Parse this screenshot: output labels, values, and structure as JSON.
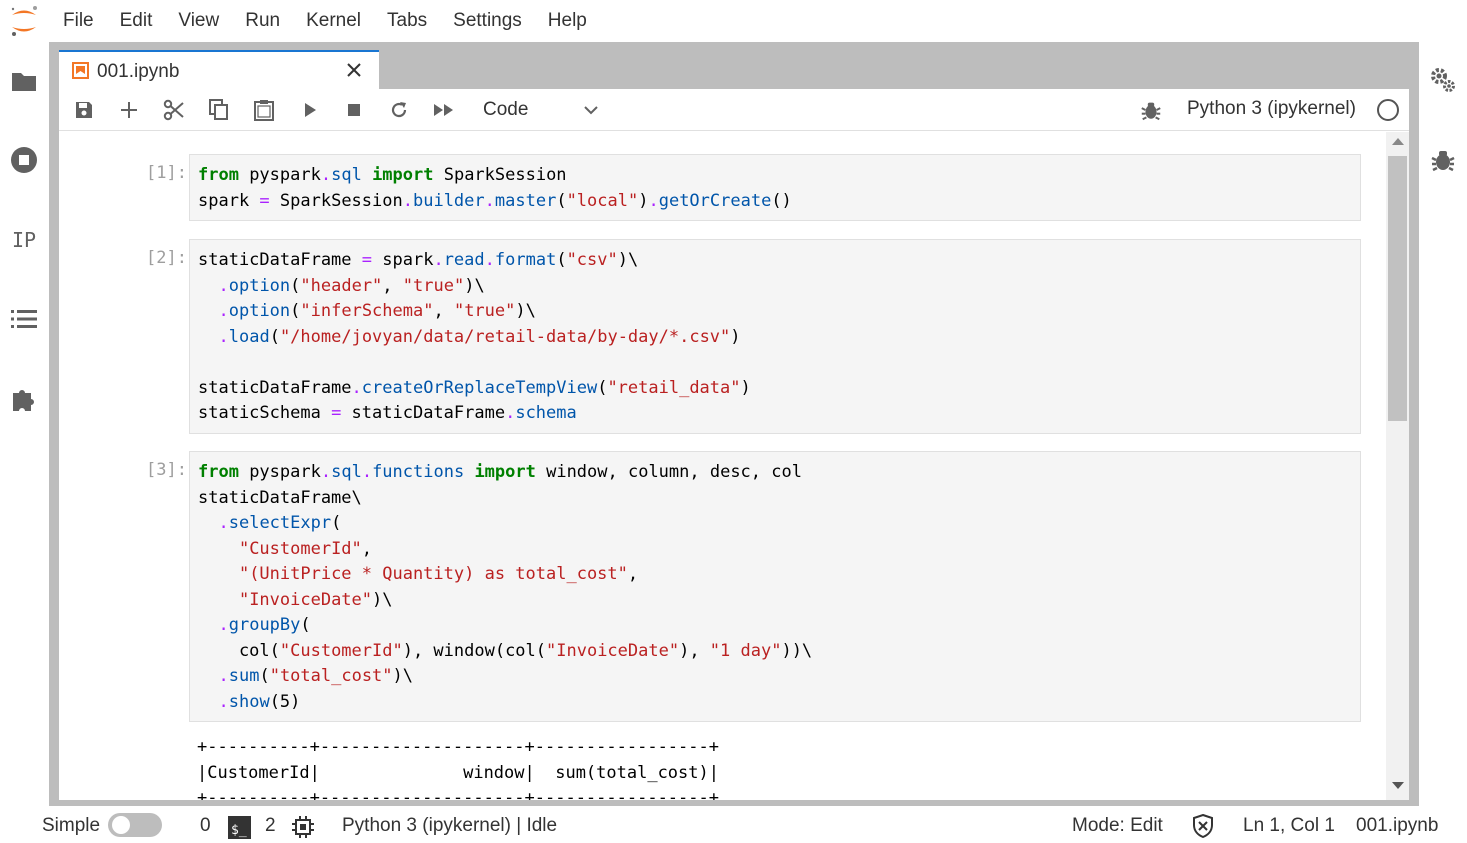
{
  "menubar": {
    "items": [
      "File",
      "Edit",
      "View",
      "Run",
      "Kernel",
      "Tabs",
      "Settings",
      "Help"
    ]
  },
  "left_sidebar": {
    "icons": [
      "folder-icon",
      "running-icon",
      "property-inspector-icon",
      "toc-icon",
      "extension-icon"
    ],
    "ip_label": "IP"
  },
  "right_sidebar": {
    "icons": [
      "property-settings-icon",
      "debugger-icon"
    ]
  },
  "tab": {
    "title": "001.ipynb"
  },
  "toolbar": {
    "buttons": [
      "save-icon",
      "add-icon",
      "cut-icon",
      "copy-icon",
      "paste-icon",
      "run-icon",
      "stop-icon",
      "restart-icon",
      "run-all-icon"
    ],
    "cell_type": "Code",
    "kernel_name": "Python 3 (ipykernel)"
  },
  "cells": [
    {
      "prompt": "[1]:",
      "lines": [
        [
          [
            "kw",
            "from"
          ],
          [
            "t",
            " pyspark"
          ],
          [
            "op",
            "."
          ],
          [
            "attr",
            "sql"
          ],
          [
            "t",
            " "
          ],
          [
            "kw",
            "import"
          ],
          [
            "t",
            " SparkSession"
          ]
        ],
        [
          [
            "t",
            "spark "
          ],
          [
            "op",
            "="
          ],
          [
            "t",
            " SparkSession"
          ],
          [
            "op",
            "."
          ],
          [
            "attr",
            "builder"
          ],
          [
            "op",
            "."
          ],
          [
            "attr",
            "master"
          ],
          [
            "t",
            "("
          ],
          [
            "str",
            "\"local\""
          ],
          [
            "t",
            ")"
          ],
          [
            "op",
            "."
          ],
          [
            "attr",
            "getOrCreate"
          ],
          [
            "t",
            "()"
          ]
        ]
      ]
    },
    {
      "prompt": "[2]:",
      "lines": [
        [
          [
            "t",
            "staticDataFrame "
          ],
          [
            "op",
            "="
          ],
          [
            "t",
            " spark"
          ],
          [
            "op",
            "."
          ],
          [
            "attr",
            "read"
          ],
          [
            "op",
            "."
          ],
          [
            "attr",
            "format"
          ],
          [
            "t",
            "("
          ],
          [
            "str",
            "\"csv\""
          ],
          [
            "t",
            ")\\"
          ]
        ],
        [
          [
            "t",
            "  "
          ],
          [
            "op",
            "."
          ],
          [
            "attr",
            "option"
          ],
          [
            "t",
            "("
          ],
          [
            "str",
            "\"header\""
          ],
          [
            "t",
            ", "
          ],
          [
            "str",
            "\"true\""
          ],
          [
            "t",
            ")\\"
          ]
        ],
        [
          [
            "t",
            "  "
          ],
          [
            "op",
            "."
          ],
          [
            "attr",
            "option"
          ],
          [
            "t",
            "("
          ],
          [
            "str",
            "\"inferSchema\""
          ],
          [
            "t",
            ", "
          ],
          [
            "str",
            "\"true\""
          ],
          [
            "t",
            ")\\"
          ]
        ],
        [
          [
            "t",
            "  "
          ],
          [
            "op",
            "."
          ],
          [
            "attr",
            "load"
          ],
          [
            "t",
            "("
          ],
          [
            "str",
            "\"/home/jovyan/data/retail-data/by-day/*.csv\""
          ],
          [
            "t",
            ")"
          ]
        ],
        [],
        [
          [
            "t",
            "staticDataFrame"
          ],
          [
            "op",
            "."
          ],
          [
            "attr",
            "createOrReplaceTempView"
          ],
          [
            "t",
            "("
          ],
          [
            "str",
            "\"retail_data\""
          ],
          [
            "t",
            ")"
          ]
        ],
        [
          [
            "t",
            "staticSchema "
          ],
          [
            "op",
            "="
          ],
          [
            "t",
            " staticDataFrame"
          ],
          [
            "op",
            "."
          ],
          [
            "attr",
            "schema"
          ]
        ]
      ]
    },
    {
      "prompt": "[3]:",
      "lines": [
        [
          [
            "kw",
            "from"
          ],
          [
            "t",
            " pyspark"
          ],
          [
            "op",
            "."
          ],
          [
            "attr",
            "sql"
          ],
          [
            "op",
            "."
          ],
          [
            "attr",
            "functions"
          ],
          [
            "t",
            " "
          ],
          [
            "kw",
            "import"
          ],
          [
            "t",
            " window, column, desc, col"
          ]
        ],
        [
          [
            "t",
            "staticDataFrame\\"
          ]
        ],
        [
          [
            "t",
            "  "
          ],
          [
            "op",
            "."
          ],
          [
            "attr",
            "selectExpr"
          ],
          [
            "t",
            "("
          ]
        ],
        [
          [
            "t",
            "    "
          ],
          [
            "str",
            "\"CustomerId\""
          ],
          [
            "t",
            ","
          ]
        ],
        [
          [
            "t",
            "    "
          ],
          [
            "str",
            "\"(UnitPrice * Quantity) as total_cost\""
          ],
          [
            "t",
            ","
          ]
        ],
        [
          [
            "t",
            "    "
          ],
          [
            "str",
            "\"InvoiceDate\""
          ],
          [
            "t",
            ")\\"
          ]
        ],
        [
          [
            "t",
            "  "
          ],
          [
            "op",
            "."
          ],
          [
            "attr",
            "groupBy"
          ],
          [
            "t",
            "("
          ]
        ],
        [
          [
            "t",
            "    col("
          ],
          [
            "str",
            "\"CustomerId\""
          ],
          [
            "t",
            "), window(col("
          ],
          [
            "str",
            "\"InvoiceDate\""
          ],
          [
            "t",
            "), "
          ],
          [
            "str",
            "\"1 day\""
          ],
          [
            "t",
            "))\\"
          ]
        ],
        [
          [
            "t",
            "  "
          ],
          [
            "op",
            "."
          ],
          [
            "attr",
            "sum"
          ],
          [
            "t",
            "("
          ],
          [
            "str",
            "\"total_cost\""
          ],
          [
            "t",
            ")\\"
          ]
        ],
        [
          [
            "t",
            "  "
          ],
          [
            "op",
            "."
          ],
          [
            "attr",
            "show"
          ],
          [
            "t",
            "(5)"
          ]
        ]
      ]
    }
  ],
  "output": {
    "lines": [
      "+----------+--------------------+-----------------+",
      "|CustomerId|              window|  sum(total_cost)|",
      "+----------+--------------------+-----------------+"
    ]
  },
  "statusbar": {
    "mode_label": "Simple",
    "terminals_count": "0",
    "kernels_count": "2",
    "kernel_status": "Python 3 (ipykernel) | Idle",
    "edit_mode": "Mode: Edit",
    "cursor_pos": "Ln 1, Col 1",
    "file_name": "001.ipynb"
  },
  "colors": {
    "accent": "#1976d2",
    "logo_orange": "#f37726",
    "frame_gray": "#bdbdbd"
  }
}
